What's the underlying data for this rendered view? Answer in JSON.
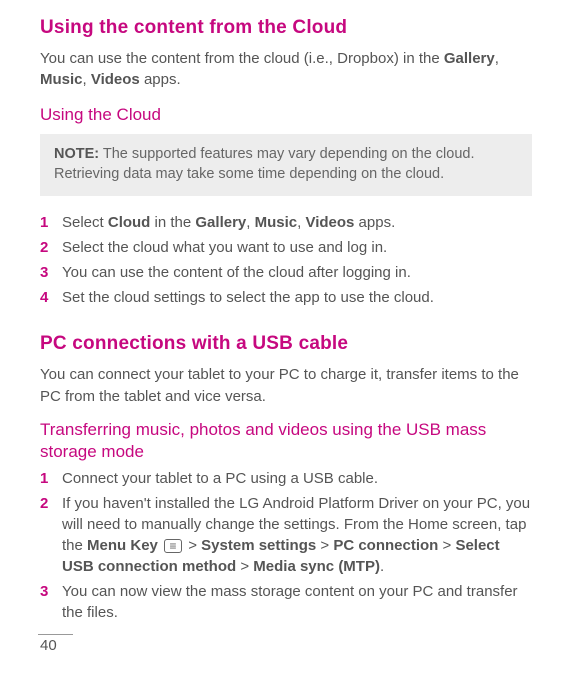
{
  "sec1": {
    "title": "Using the content from the Cloud",
    "intro_pre": "You can use the content from the cloud (i.e., Dropbox) in the ",
    "intro_b1": "Gallery",
    "intro_c1": ", ",
    "intro_b2": "Music",
    "intro_c2": ", ",
    "intro_b3": "Videos",
    "intro_post": " apps.",
    "sub": "Using the Cloud",
    "note_label": "NOTE:",
    "note_text": " The supported features may vary depending on the cloud. Retrieving data may take some time depending on the cloud.",
    "step1": {
      "num": "1",
      "pre": "Select ",
      "b1": "Cloud",
      "mid1": " in the ",
      "b2": "Gallery",
      "c1": ", ",
      "b3": "Music",
      "c2": ", ",
      "b4": "Videos",
      "post": " apps."
    },
    "step2": {
      "num": "2",
      "text": "Select the cloud what you want to use and log in."
    },
    "step3": {
      "num": "3",
      "text": "You can use the content of the cloud after logging in."
    },
    "step4": {
      "num": "4",
      "text": "Set the cloud settings to select the app to use the cloud."
    }
  },
  "sec2": {
    "title": "PC connections with a USB cable",
    "intro": "You can connect your tablet to your PC to charge it, transfer items to the PC from the tablet and vice versa.",
    "sub": "Transferring music, photos and videos using the USB mass storage mode",
    "step1": {
      "num": "1",
      "text": "Connect your tablet to a PC using a USB cable."
    },
    "step2": {
      "num": "2",
      "pre": "If you haven't installed the LG Android Platform Driver on your PC, you will need to manually change the settings. From the Home screen, tap the ",
      "b1": "Menu Key",
      "sp1": " ",
      "gt1": " > ",
      "b2": "System settings",
      "gt2": " > ",
      "b3": "PC connection",
      "gt3": " > ",
      "b4": "Select USB connection method",
      "gt4": " > ",
      "b5": "Media sync (MTP)",
      "post": "."
    },
    "step3": {
      "num": "3",
      "text": "You can now view the mass storage content on your PC and transfer the files."
    }
  },
  "page": "40"
}
